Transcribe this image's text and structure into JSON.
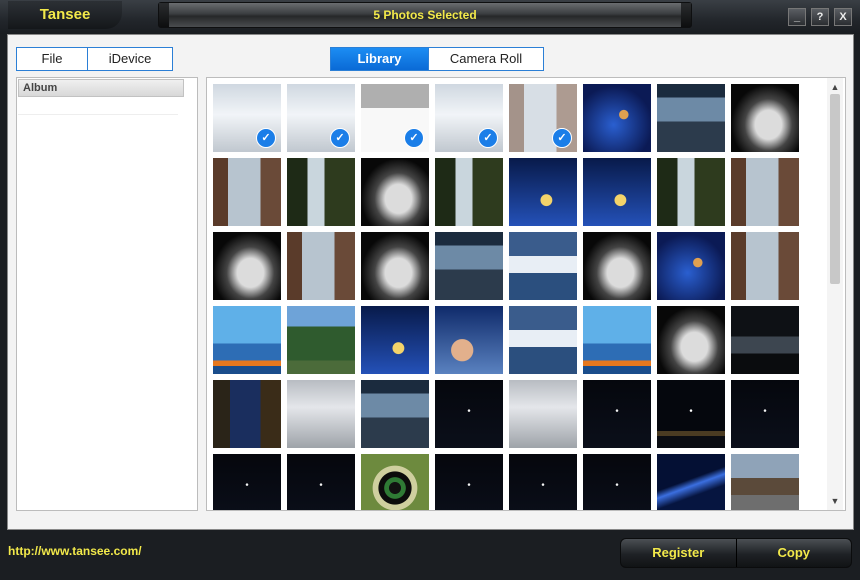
{
  "app": {
    "title": "Tansee",
    "status": "5 Photos Selected"
  },
  "window_buttons": {
    "minimize": "_",
    "help": "?",
    "close": "X"
  },
  "source_tabs": [
    {
      "label": "File"
    },
    {
      "label": "iDevice"
    }
  ],
  "view_tabs": [
    {
      "label": "Library",
      "active": true
    },
    {
      "label": "Camera Roll",
      "active": false
    }
  ],
  "album_panel": {
    "header": "Album"
  },
  "footer": {
    "link": "http://www.tansee.com/",
    "register_label": "Register",
    "copy_label": "Copy"
  },
  "photos": [
    {
      "style": "misty",
      "selected": true
    },
    {
      "style": "misty",
      "selected": true
    },
    {
      "style": "gray",
      "selected": true
    },
    {
      "style": "misty",
      "selected": true
    },
    {
      "style": "venice",
      "selected": true
    },
    {
      "style": "swirl",
      "selected": false
    },
    {
      "style": "harbor",
      "selected": false
    },
    {
      "style": "arch",
      "selected": false
    },
    {
      "style": "venice",
      "selected": false
    },
    {
      "style": "waterfall",
      "selected": false
    },
    {
      "style": "arch",
      "selected": false
    },
    {
      "style": "waterfall",
      "selected": false
    },
    {
      "style": "moon",
      "selected": false
    },
    {
      "style": "moon",
      "selected": false
    },
    {
      "style": "waterfall",
      "selected": false
    },
    {
      "style": "venice",
      "selected": false
    },
    {
      "style": "arch",
      "selected": false
    },
    {
      "style": "venice",
      "selected": false
    },
    {
      "style": "arch",
      "selected": false
    },
    {
      "style": "harbor",
      "selected": false
    },
    {
      "style": "snow",
      "selected": false
    },
    {
      "style": "arch",
      "selected": false
    },
    {
      "style": "swirl",
      "selected": false
    },
    {
      "style": "venice",
      "selected": false
    },
    {
      "style": "bluedesk",
      "selected": false
    },
    {
      "style": "forest",
      "selected": false
    },
    {
      "style": "moon",
      "selected": false
    },
    {
      "style": "kid",
      "selected": false
    },
    {
      "style": "snow",
      "selected": false
    },
    {
      "style": "bluedesk",
      "selected": false
    },
    {
      "style": "arch",
      "selected": false
    },
    {
      "style": "night",
      "selected": false
    },
    {
      "style": "canal",
      "selected": false
    },
    {
      "style": "screen",
      "selected": false
    },
    {
      "style": "harbor",
      "selected": false
    },
    {
      "style": "dark",
      "selected": false
    },
    {
      "style": "screen",
      "selected": false
    },
    {
      "style": "dark",
      "selected": false
    },
    {
      "style": "darkcity",
      "selected": false
    },
    {
      "style": "dark",
      "selected": false
    },
    {
      "style": "dark",
      "selected": false
    },
    {
      "style": "dark",
      "selected": false
    },
    {
      "style": "dartboard",
      "selected": false
    },
    {
      "style": "dark",
      "selected": false
    },
    {
      "style": "dark",
      "selected": false
    },
    {
      "style": "dark",
      "selected": false
    },
    {
      "style": "bluestreak",
      "selected": false
    },
    {
      "style": "street",
      "selected": false
    }
  ]
}
